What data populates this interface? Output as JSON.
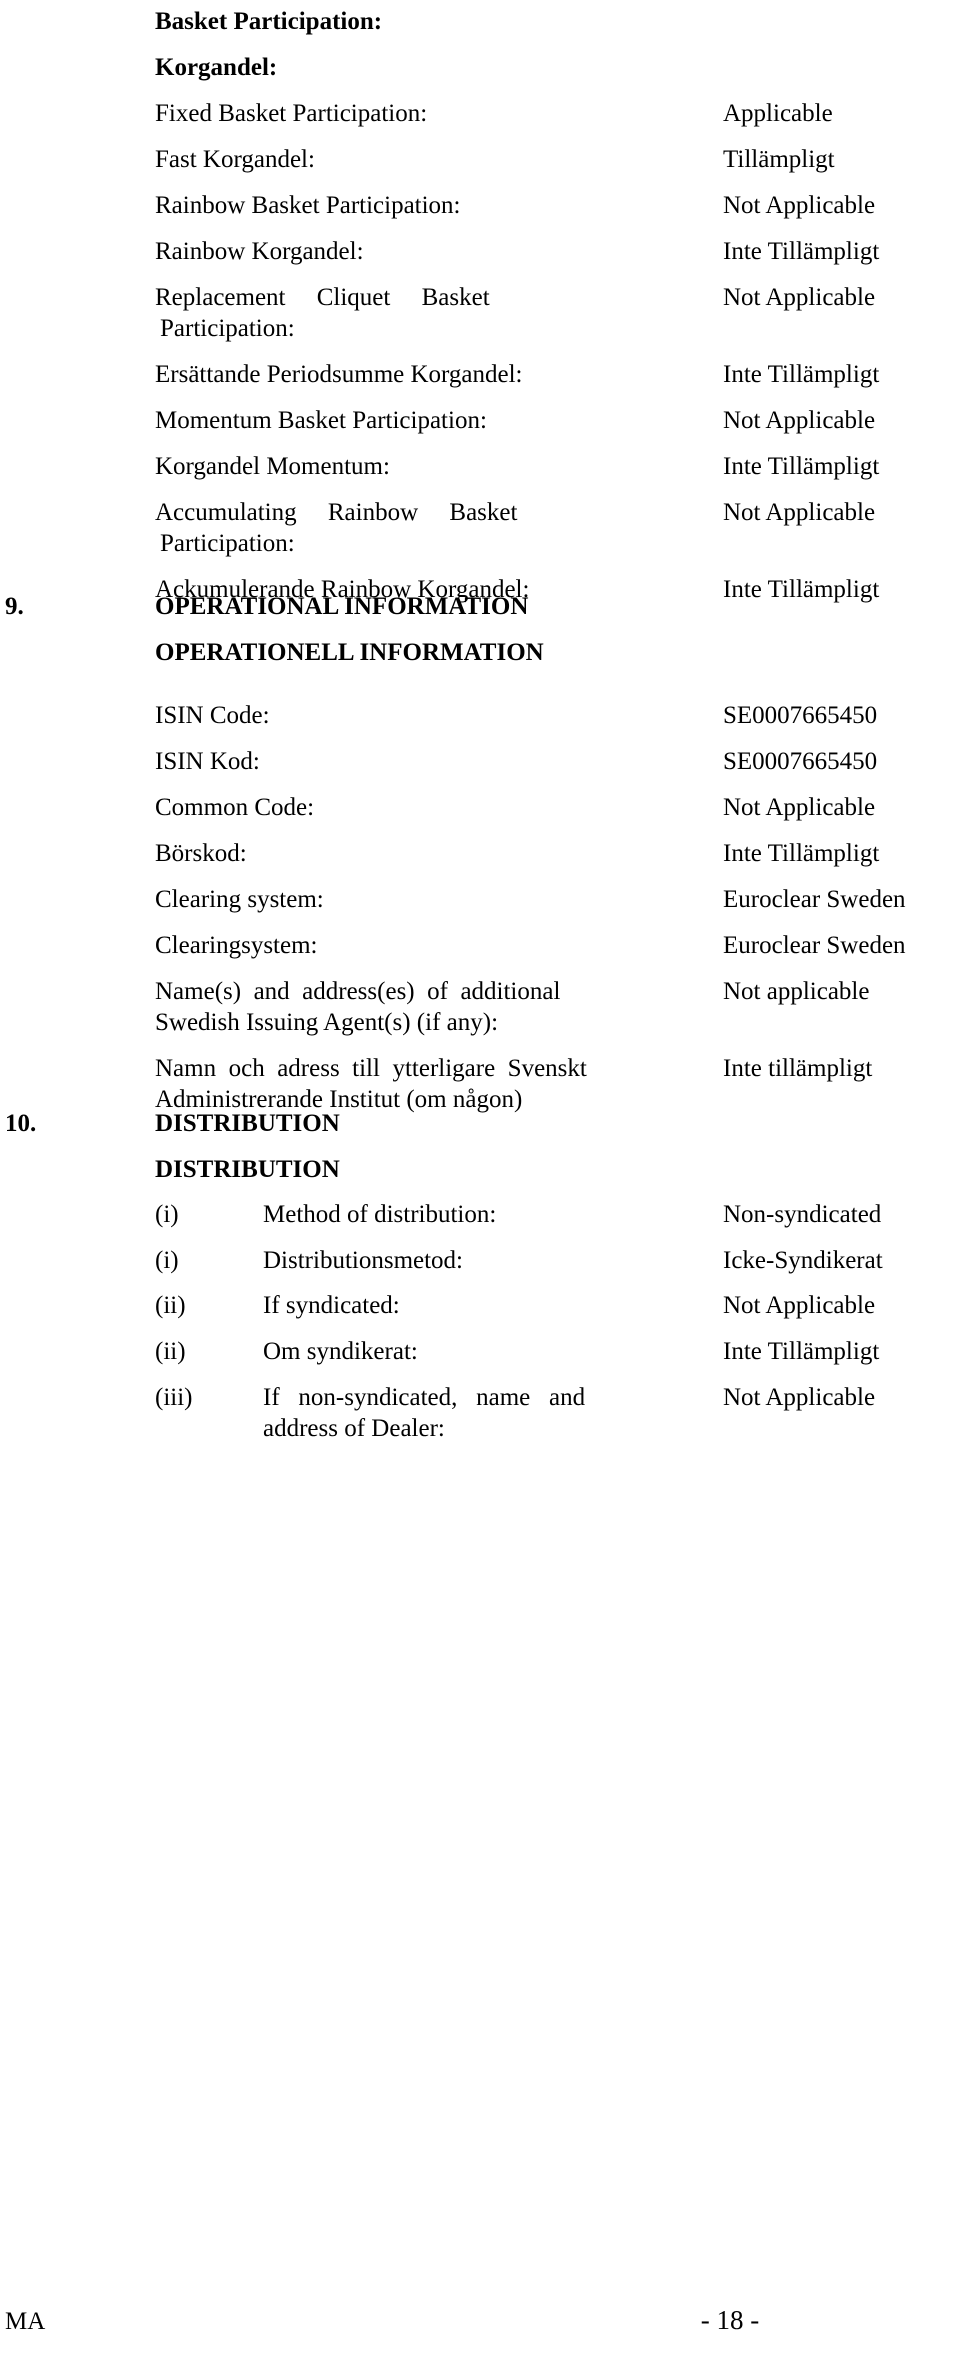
{
  "document": {
    "basket_heading_en": "Basket Participation:",
    "basket_heading_sv": "Korgandel:",
    "basket_rows": [
      {
        "label": "Fixed Basket Participation:",
        "value": "Applicable"
      },
      {
        "label": "Fast Korgandel:",
        "value": "Tillämpligt"
      },
      {
        "label": "Rainbow Basket Participation:",
        "value": "Not Applicable"
      },
      {
        "label": "Rainbow Korgandel:",
        "value": "Inte Tillämpligt"
      },
      {
        "label_line1": "Replacement     Cliquet     Basket",
        "label_line2": "Participation:",
        "value": "Not Applicable"
      },
      {
        "label": "Ersättande Periodsumme Korgandel:",
        "value": "Inte Tillämpligt"
      },
      {
        "label": "Momentum Basket Participation:",
        "value": "Not Applicable"
      },
      {
        "label": "Korgandel Momentum:",
        "value": "Inte Tillämpligt"
      },
      {
        "label_line1": "Accumulating     Rainbow     Basket",
        "label_line2": "Participation:",
        "value": "Not Applicable"
      },
      {
        "label": "Ackumulerande Rainbow Korgandel:",
        "value": "Inte Tillämpligt"
      }
    ],
    "section9": {
      "number": "9.",
      "title_en": "OPERATIONAL INFORMATION",
      "title_sv": "OPERATIONELL INFORMATION",
      "rows": [
        {
          "label": "ISIN Code:",
          "value": "SE0007665450"
        },
        {
          "label": "ISIN Kod:",
          "value": "SE0007665450"
        },
        {
          "label": "Common Code:",
          "value": "Not Applicable"
        },
        {
          "label": "Börskod:",
          "value": "Inte Tillämpligt"
        },
        {
          "label": "Clearing system:",
          "value": "Euroclear Sweden"
        },
        {
          "label": "Clearingsystem:",
          "value": "Euroclear Sweden"
        },
        {
          "label_line1": "Name(s)  and  address(es)  of  additional",
          "label_line2": "Swedish Issuing Agent(s) (if any):",
          "value": "Not applicable"
        },
        {
          "label_line1": "Namn  och  adress  till  ytterligare  Svenskt",
          "label_line2": "Administrerande Institut (om någon)",
          "value": "Inte tillämpligt"
        }
      ]
    },
    "section10": {
      "number": "10.",
      "title_en": "DISTRIBUTION",
      "title_sv": "DISTRIBUTION",
      "rows": [
        {
          "roman": "(i)",
          "label": "Method of distribution:",
          "value": "Non-syndicated"
        },
        {
          "roman": "(i)",
          "label": "Distributionsmetod:",
          "value": "Icke-Syndikerat"
        },
        {
          "roman": "(ii)",
          "label": "If syndicated:",
          "value": "Not Applicable"
        },
        {
          "roman": "(ii)",
          "label": "Om syndikerat:",
          "value": "Inte Tillämpligt"
        },
        {
          "roman": "(iii)",
          "label_line1": "If   non-syndicated,   name   and",
          "label_line2": "address of Dealer:",
          "value": "Not Applicable"
        }
      ]
    },
    "footer": {
      "left_mark": "MA",
      "page_number": "- 18 -"
    }
  }
}
